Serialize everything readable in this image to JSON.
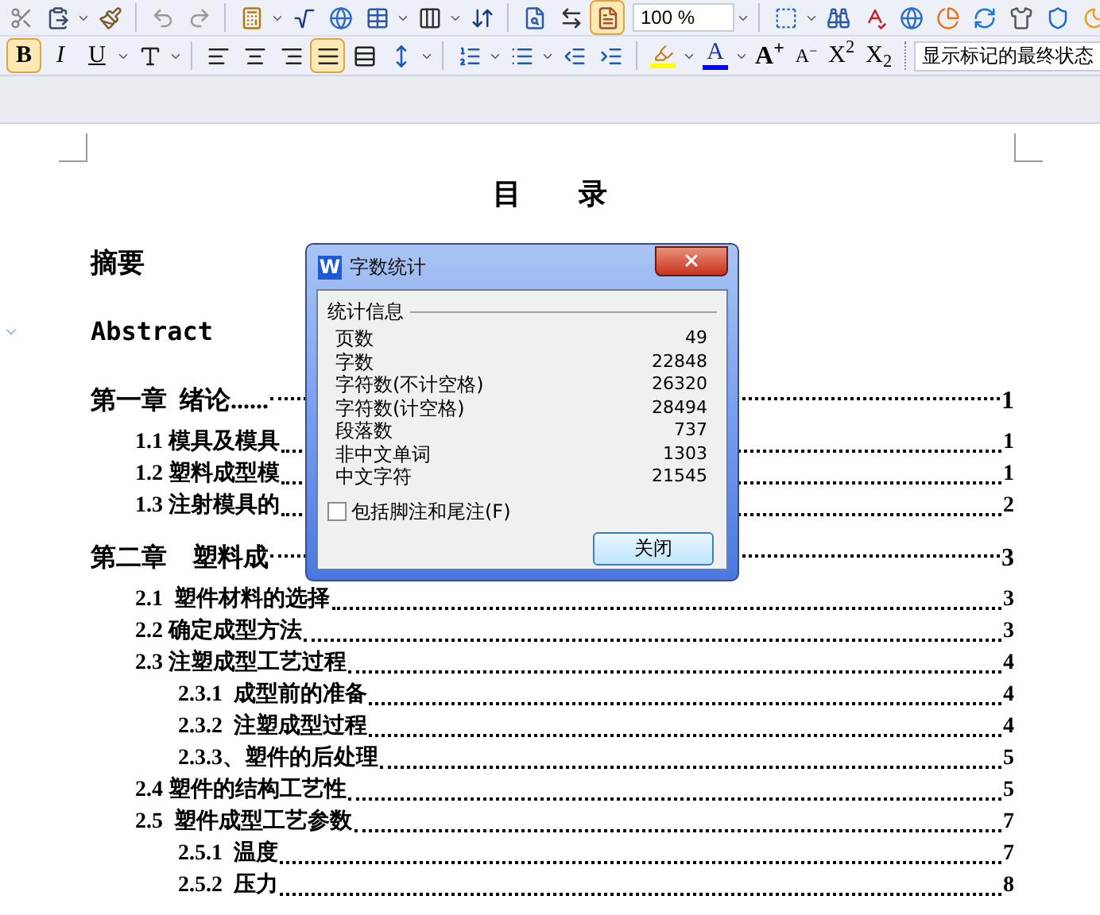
{
  "toolbar": {
    "zoom_value": "100 %",
    "page_view_selected": true
  },
  "format_bar": {
    "style_buttons": [
      {
        "label": "B",
        "selected": true
      },
      {
        "label": "I",
        "selected": false
      },
      {
        "label": "U",
        "selected": false
      }
    ],
    "align_buttons": [
      {
        "kind": "left",
        "selected": false
      },
      {
        "kind": "center",
        "selected": false
      },
      {
        "kind": "right",
        "selected": false
      },
      {
        "kind": "justify",
        "selected": true
      },
      {
        "kind": "distributed",
        "selected": false
      }
    ],
    "font_color_label": "A",
    "grow_label": "A$^{+}$",
    "shrink_label": "A$^{−}$",
    "superscript_label": "X$^{2}$",
    "subscript_label": "X$_{2}$",
    "markup_mode": "显示标记的最终状态"
  },
  "document": {
    "title": "目　　录",
    "entries": [
      {
        "kind": "plain",
        "text": "摘要"
      },
      {
        "kind": "plain_latin",
        "text": "Abstract"
      },
      {
        "kind": "chapter",
        "text": "第一章  绪论......",
        "page": "1"
      },
      {
        "kind": "section",
        "text": "1.1 模具及模具",
        "page": "1"
      },
      {
        "kind": "section",
        "text": "1.2 塑料成型模",
        "page": "1"
      },
      {
        "kind": "section",
        "text": "1.3 注射模具的",
        "page": "2"
      },
      {
        "kind": "chapter",
        "text": "第二章    塑料成",
        "page": "3"
      },
      {
        "kind": "section",
        "text": "2.1  塑件材料的选择",
        "page": "3"
      },
      {
        "kind": "section",
        "text": "2.2 确定成型方法",
        "page": "3"
      },
      {
        "kind": "section",
        "text": "2.3 注塑成型工艺过程",
        "page": "4"
      },
      {
        "kind": "subsection",
        "text": "2.3.1  成型前的准备",
        "page": "4"
      },
      {
        "kind": "subsection",
        "text": "2.3.2  注塑成型过程",
        "page": "4"
      },
      {
        "kind": "subsection",
        "text": "2.3.3、塑件的后处理",
        "page": "5"
      },
      {
        "kind": "section",
        "text": "2.4 塑件的结构工艺性",
        "page": "5"
      },
      {
        "kind": "section",
        "text": "2.5  塑件成型工艺参数",
        "page": "7"
      },
      {
        "kind": "subsection",
        "text": "2.5.1  温度",
        "page": "7"
      },
      {
        "kind": "subsection",
        "text": "2.5.2  压力",
        "page": "8"
      }
    ]
  },
  "dialog": {
    "logo": "W",
    "title": "字数统计",
    "group_label": "统计信息",
    "stats": [
      {
        "label": "页数",
        "value": "49"
      },
      {
        "label": "字数",
        "value": "22848"
      },
      {
        "label": "字符数(不计空格)",
        "value": "26320"
      },
      {
        "label": "字符数(计空格)",
        "value": "28494"
      },
      {
        "label": "段落数",
        "value": "737"
      },
      {
        "label": "非中文单词",
        "value": "1303"
      },
      {
        "label": "中文字符",
        "value": "21545"
      }
    ],
    "checkbox": {
      "label": "包括脚注和尾注(F)",
      "checked": false
    },
    "button": "关闭"
  }
}
